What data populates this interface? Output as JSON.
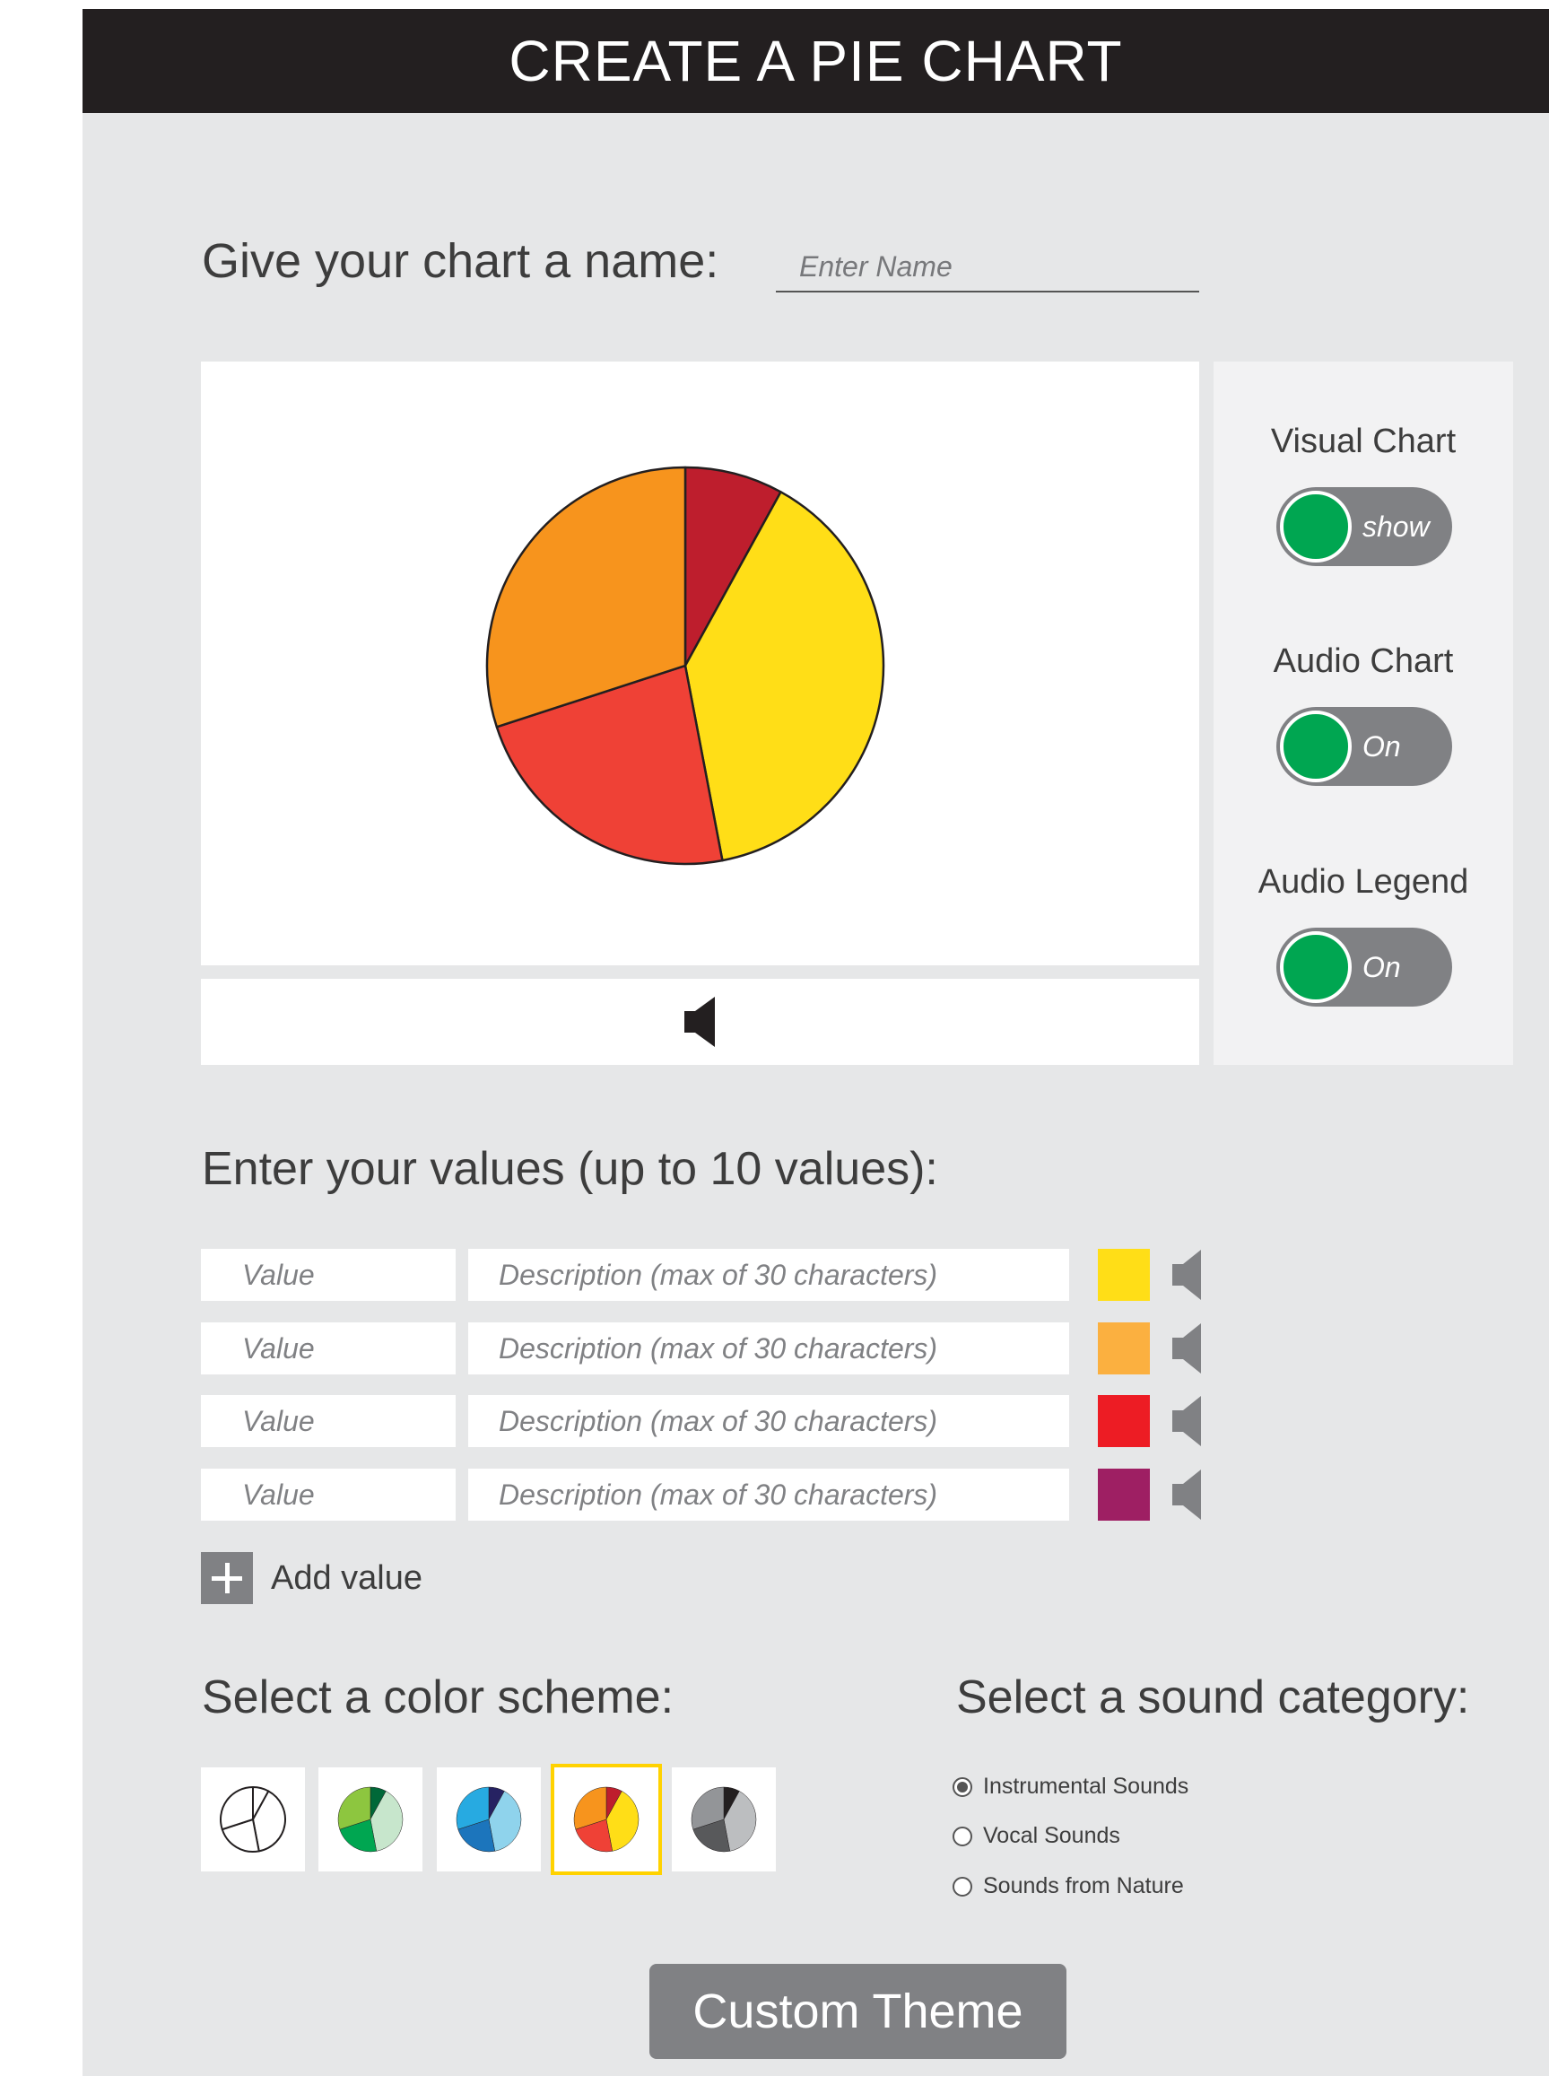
{
  "header": {
    "title": "CREATE A PIE CHART"
  },
  "name": {
    "label": "Give your chart a name:",
    "placeholder": "Enter Name",
    "value": ""
  },
  "chart_data": {
    "type": "pie",
    "values": [
      8,
      39,
      23,
      30
    ],
    "colors": [
      "#be1e2d",
      "#ffde17",
      "#ef4136",
      "#f7941d"
    ]
  },
  "audio_bar": {
    "icon": "speaker-icon"
  },
  "toggles": [
    {
      "label": "Visual Chart",
      "state": "show"
    },
    {
      "label": "Audio Chart",
      "state": "On"
    },
    {
      "label": "Audio Legend",
      "state": "On"
    }
  ],
  "values_section": {
    "title": "Enter your values (up to 10 values):",
    "rows": [
      {
        "value_placeholder": "Value",
        "description_placeholder": "Description (max of 30 characters)",
        "color": "#ffde17"
      },
      {
        "value_placeholder": "Value",
        "description_placeholder": "Description (max of 30 characters)",
        "color": "#fbb040"
      },
      {
        "value_placeholder": "Value",
        "description_placeholder": "Description (max of 30 characters)",
        "color": "#ed1c24"
      },
      {
        "value_placeholder": "Value",
        "description_placeholder": "Description (max of 30 characters)",
        "color": "#9e1f63"
      }
    ],
    "add_label": "Add value"
  },
  "color_scheme": {
    "title": "Select a color scheme:",
    "selected_index": 3,
    "schemes": [
      {
        "name": "outline",
        "colors": [
          "#ffffff",
          "#ffffff",
          "#ffffff",
          "#ffffff"
        ]
      },
      {
        "name": "greens",
        "colors": [
          "#006838",
          "#c7e6cc",
          "#00a651",
          "#8dc63f"
        ]
      },
      {
        "name": "blues",
        "colors": [
          "#262262",
          "#8fd3ec",
          "#1c75bc",
          "#27aae1"
        ]
      },
      {
        "name": "warm",
        "colors": [
          "#be1e2d",
          "#ffde17",
          "#ef4136",
          "#f7941d"
        ]
      },
      {
        "name": "grays",
        "colors": [
          "#231f20",
          "#bcbec0",
          "#58595b",
          "#939598"
        ]
      }
    ]
  },
  "sound_category": {
    "title": "Select a sound category:",
    "selected": 0,
    "options": [
      "Instrumental Sounds",
      "Vocal Sounds",
      "Sounds from Nature"
    ]
  },
  "custom_theme": {
    "label": "Custom Theme"
  }
}
